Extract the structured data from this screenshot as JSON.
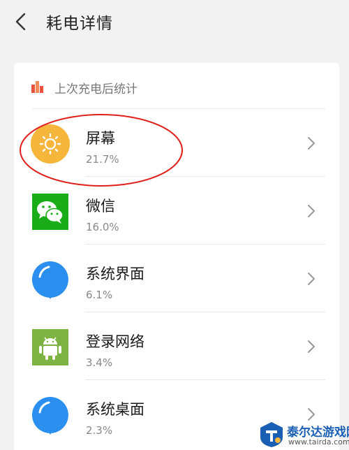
{
  "header": {
    "title": "耗电详情",
    "back_icon": "chevron-left-icon"
  },
  "card": {
    "heading": "上次充电后统计",
    "heading_icon": "bar-chart-icon",
    "items": [
      {
        "name": "屏幕",
        "percent": "21.7%",
        "icon": "sun-icon",
        "color": "#f6b53b"
      },
      {
        "name": "微信",
        "percent": "16.0%",
        "icon": "wechat-icon",
        "color": "#1aad19"
      },
      {
        "name": "系统界面",
        "percent": "6.1%",
        "icon": "blue-bubble-icon",
        "color": "#2b8ff0"
      },
      {
        "name": "登录网络",
        "percent": "3.4%",
        "icon": "android-icon",
        "color": "#7cb342"
      },
      {
        "name": "系统桌面",
        "percent": "2.3%",
        "icon": "blue-bubble-icon",
        "color": "#2b8ff0"
      }
    ]
  },
  "annotation": {
    "color": "#e0201b"
  },
  "watermark": {
    "title": "泰尔达游戏网",
    "url": "www.tairda.com"
  }
}
